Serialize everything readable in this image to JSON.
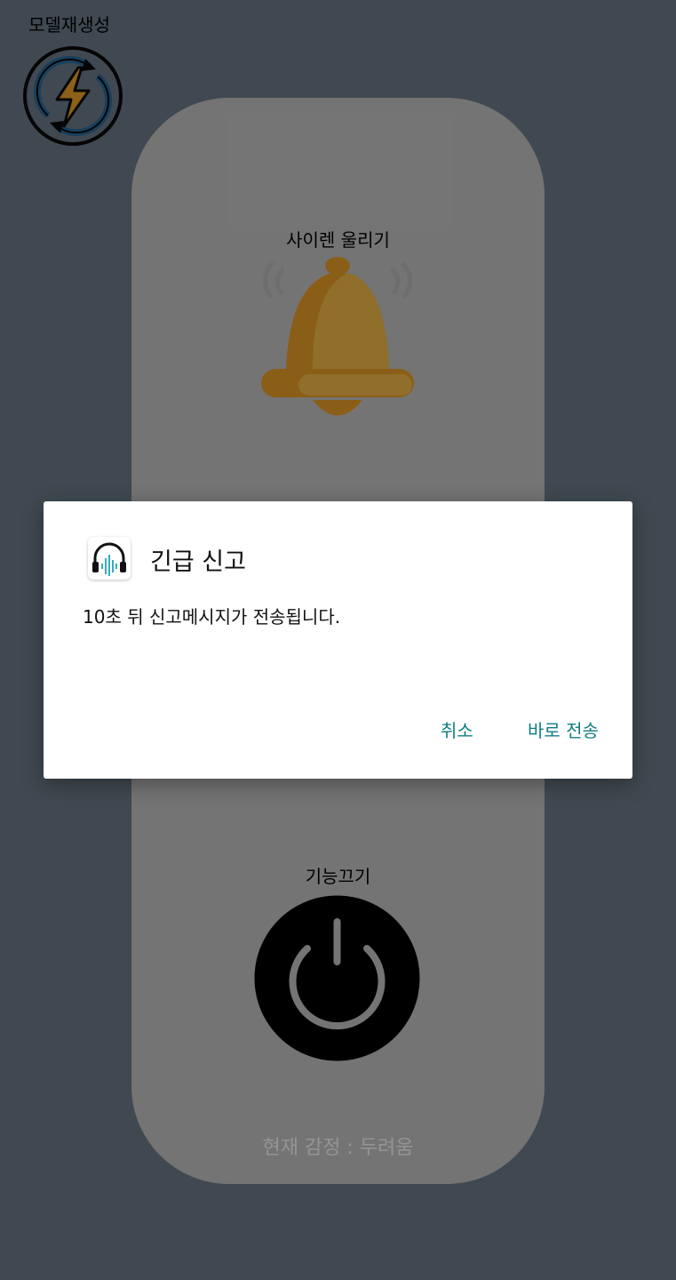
{
  "screen": {
    "model_regen_label": "모델재생성",
    "siren_label": "사이렌 울리기",
    "power_label": "기능끄기",
    "emotion_text": "현재 감정 : 두려움"
  },
  "dialog": {
    "title": "긴급 신고",
    "message": "10초 뒤 신고메시지가 전송됩니다.",
    "cancel_label": "취소",
    "send_now_label": "바로 전송"
  },
  "icons": {
    "model_regen": "refresh-lightning-icon",
    "siren": "bell-icon",
    "power": "power-icon",
    "dialog": "headphones-soundwave-icon"
  },
  "colors": {
    "background": "#6f7e8c",
    "panel": "#c9c9c9",
    "bell": "#f0a32a",
    "accent_button": "#107d80"
  }
}
